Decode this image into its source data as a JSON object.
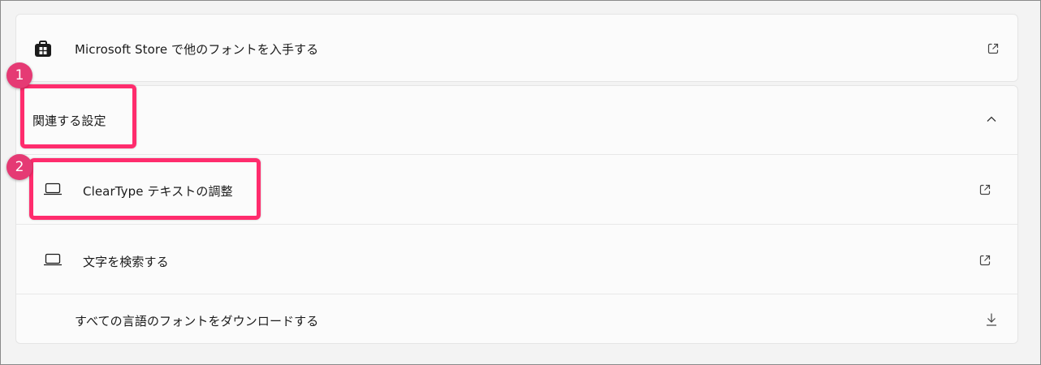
{
  "store": {
    "label": "Microsoft Store で他のフォントを入手する",
    "icon": "store-bag-icon",
    "action_icon": "open-external-icon"
  },
  "related": {
    "header": "関連する設定",
    "expand_icon": "chevron-up-icon",
    "items": [
      {
        "label": "ClearType テキストの調整",
        "icon": "laptop-icon",
        "action_icon": "open-external-icon"
      },
      {
        "label": "文字を検索する",
        "icon": "laptop-icon",
        "action_icon": "open-external-icon"
      },
      {
        "label": "すべての言語のフォントをダウンロードする",
        "icon": "",
        "action_icon": "download-icon"
      }
    ]
  },
  "annotations": {
    "badge1": "1",
    "badge2": "2",
    "highlight_color": "#ff2c6d",
    "badge_color": "#e53a74"
  }
}
